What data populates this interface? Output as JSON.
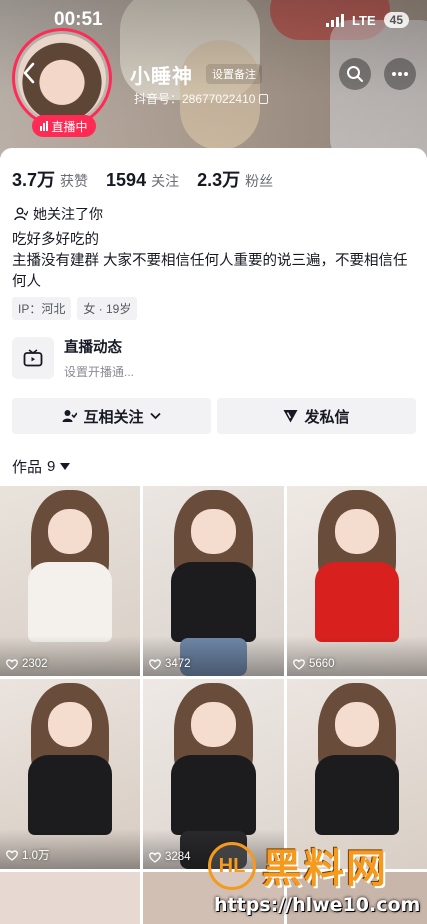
{
  "status_bar": {
    "time": "00:51",
    "network": "LTE",
    "battery": "45"
  },
  "profile": {
    "nickname": "小睡神",
    "remark_button": "设置备注",
    "douyin_id": "抖音号：28677022410",
    "live_badge": "直播中"
  },
  "stats": [
    {
      "value": "3.7万",
      "label": "获赞"
    },
    {
      "value": "1594",
      "label": "关注"
    },
    {
      "value": "2.3万",
      "label": "粉丝"
    }
  ],
  "follows_you": "她关注了你",
  "bio_lines": [
    "吃好多好吃的",
    "主播没有建群  大家不要相信任何人重要的说三遍，不要相信任何人"
  ],
  "tags": [
    "IP：河北",
    "女 · 19岁"
  ],
  "live_dynamic": {
    "title": "直播动态",
    "subtitle": "设置开播通..."
  },
  "actions": {
    "mutual_follow": "互相关注",
    "send_message": "发私信"
  },
  "works": {
    "label": "作品",
    "count": "9"
  },
  "videos": [
    {
      "likes": "2302",
      "top": "white"
    },
    {
      "likes": "3472",
      "top": "black"
    },
    {
      "likes": "5660",
      "top": "red"
    },
    {
      "likes": "",
      "top": "black"
    },
    {
      "likes": "3284",
      "top": "black"
    },
    {
      "likes": "",
      "top": "black"
    }
  ],
  "video_row2_first_likes": "1.0万",
  "watermark": {
    "logo": "HL",
    "title": "黑料网",
    "url": "https://hlwe10.com"
  },
  "colors": {
    "accent": "#fe2c55",
    "watermark": "#f39a1f"
  },
  "icons": [
    "back-icon",
    "search-icon",
    "more-icon",
    "copy-icon",
    "person-icon",
    "tv-icon",
    "person-check-icon",
    "chevron-down-icon",
    "send-icon",
    "caret-down-icon",
    "heart-icon"
  ]
}
